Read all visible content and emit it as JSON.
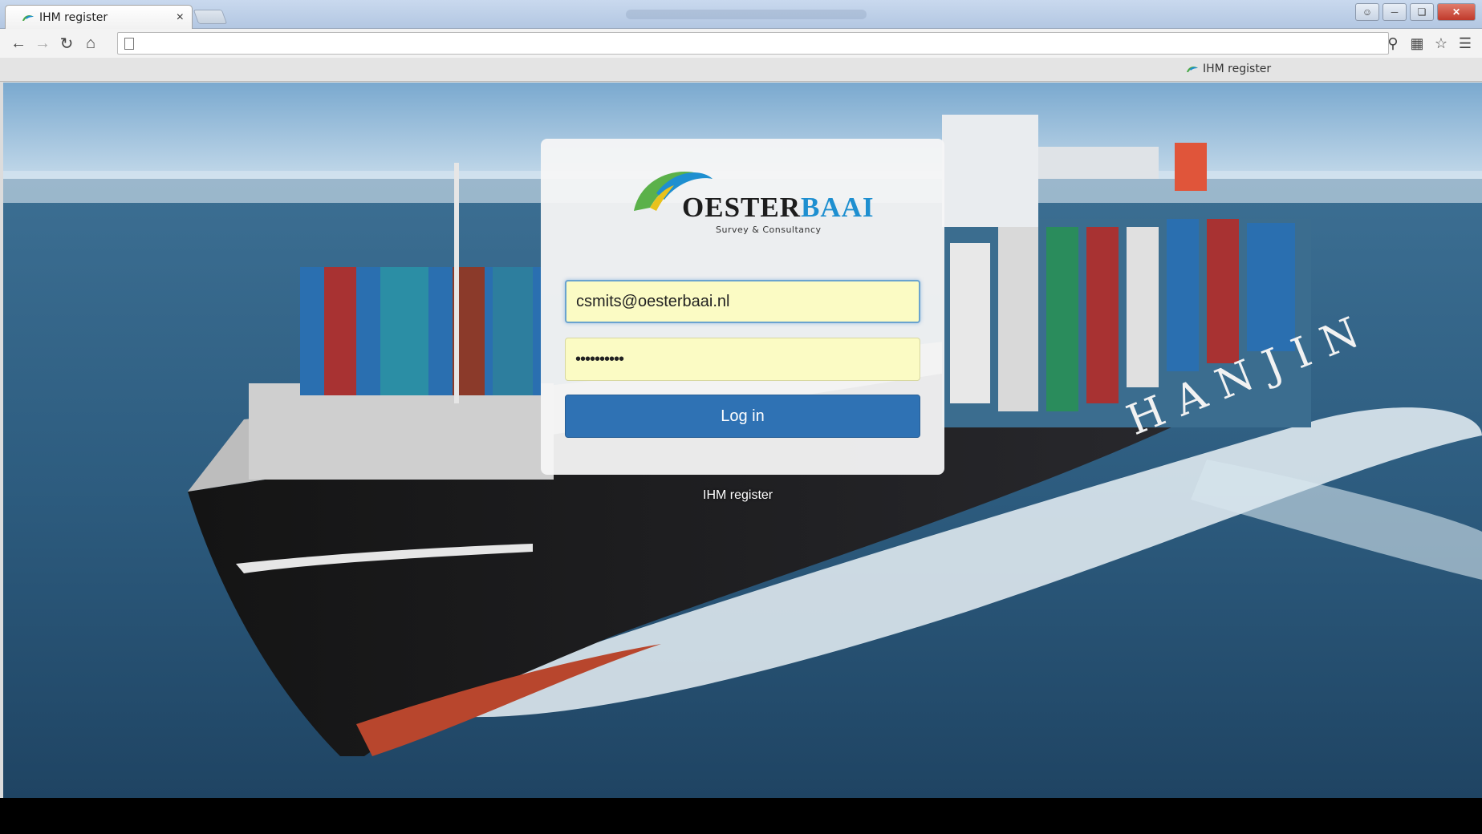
{
  "browser": {
    "tab_title": "IHM register",
    "tab_close": "×",
    "address": "",
    "bookmark_label": "IHM register"
  },
  "login": {
    "logo_word1": "OESTER",
    "logo_word2": "BAAI",
    "logo_tagline": "Survey & Consultancy",
    "email_value": "csmits@oesterbaai.nl",
    "password_value": "••••••••••",
    "login_label": "Log in",
    "footer_label": "IHM register"
  },
  "icons": {
    "back": "back-arrow-icon",
    "forward": "forward-arrow-icon",
    "reload": "reload-icon",
    "home": "home-icon",
    "page": "page-icon",
    "key": "key-icon",
    "translate": "translate-icon",
    "star": "star-icon",
    "menu": "menu-icon"
  },
  "colors": {
    "brand_blue": "#1e8fd0",
    "button_blue": "#2f72b4",
    "autofill_yellow": "#fbfbc4"
  }
}
